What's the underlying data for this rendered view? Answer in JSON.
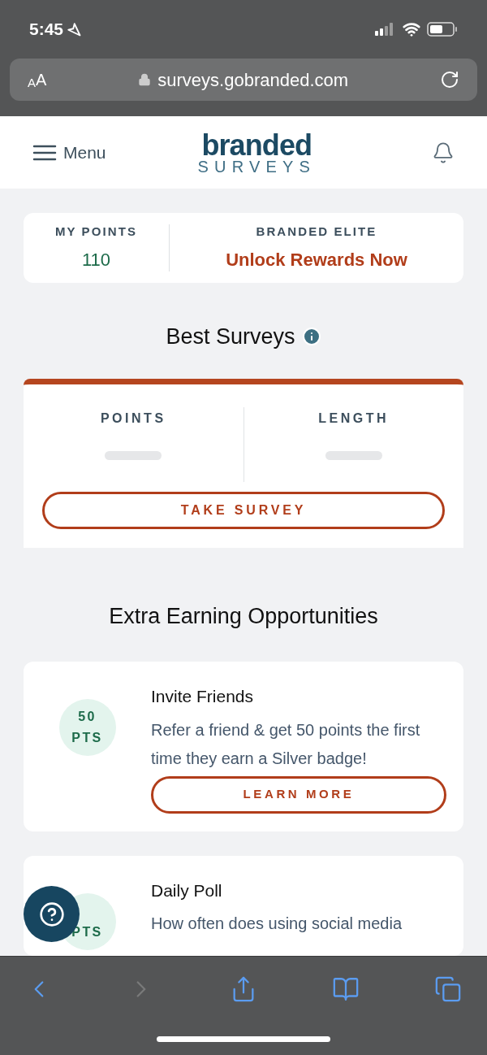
{
  "status_bar": {
    "time": "5:45"
  },
  "browser": {
    "text_size": "AA",
    "url": "surveys.gobranded.com"
  },
  "header": {
    "menu_label": "Menu",
    "logo": {
      "top": "branded",
      "bottom": "SURVEYS"
    }
  },
  "points_card": {
    "my_points": {
      "label": "MY POINTS",
      "value": "110"
    },
    "elite": {
      "label": "BRANDED ELITE",
      "link": "Unlock Rewards Now"
    }
  },
  "best_surveys": {
    "title": "Best Surveys",
    "columns": [
      {
        "label": "POINTS"
      },
      {
        "label": "LENGTH"
      }
    ],
    "button": "TAKE SURVEY"
  },
  "extra": {
    "title": "Extra Earning Opportunities",
    "cards": [
      {
        "points": "50",
        "unit": "PTS",
        "title": "Invite Friends",
        "text": "Refer a friend & get 50 points the first time they earn a Silver badge!",
        "button": "LEARN MORE"
      },
      {
        "unit": "PTS",
        "title": "Daily Poll",
        "text": "How often does using social media"
      }
    ]
  },
  "toolbar": {
    "buttons": [
      {
        "kind": "back",
        "disabled": false
      },
      {
        "kind": "forward",
        "disabled": true
      },
      {
        "kind": "share",
        "disabled": false
      },
      {
        "kind": "bookmarks",
        "disabled": false
      },
      {
        "kind": "tabs",
        "disabled": false
      }
    ]
  }
}
